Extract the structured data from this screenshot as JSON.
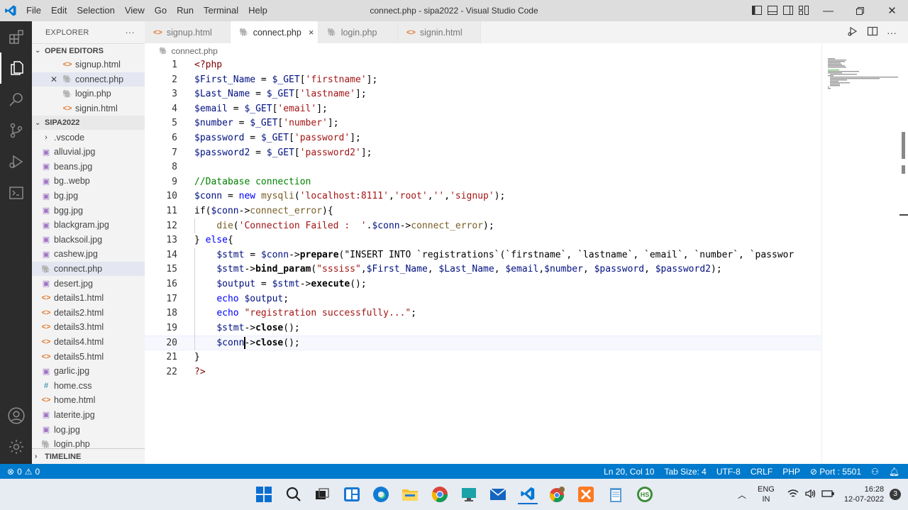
{
  "window": {
    "title": "connect.php - sipa2022 - Visual Studio Code",
    "menu": [
      "File",
      "Edit",
      "Selection",
      "View",
      "Go",
      "Run",
      "Terminal",
      "Help"
    ]
  },
  "sidebar": {
    "header": "EXPLORER",
    "more": "···",
    "open_editors_label": "OPEN EDITORS",
    "open_editors": [
      {
        "name": "signup.html",
        "icon": "html-icon"
      },
      {
        "name": "connect.php",
        "icon": "php-icon"
      },
      {
        "name": "login.php",
        "icon": "php-icon"
      },
      {
        "name": "signin.html",
        "icon": "html-icon"
      }
    ],
    "folder_label": "SIPA2022",
    "files": [
      {
        "name": ".vscode",
        "type": "folder"
      },
      {
        "name": "alluvial.jpg",
        "type": "img"
      },
      {
        "name": "beans.jpg",
        "type": "img"
      },
      {
        "name": "bg..webp",
        "type": "img"
      },
      {
        "name": "bg.jpg",
        "type": "img"
      },
      {
        "name": "bgg.jpg",
        "type": "img"
      },
      {
        "name": "blackgram.jpg",
        "type": "img"
      },
      {
        "name": "blacksoil.jpg",
        "type": "img"
      },
      {
        "name": "cashew.jpg",
        "type": "img"
      },
      {
        "name": "connect.php",
        "type": "php"
      },
      {
        "name": "desert.jpg",
        "type": "img"
      },
      {
        "name": "details1.html",
        "type": "html"
      },
      {
        "name": "details2.html",
        "type": "html"
      },
      {
        "name": "details3.html",
        "type": "html"
      },
      {
        "name": "details4.html",
        "type": "html"
      },
      {
        "name": "details5.html",
        "type": "html"
      },
      {
        "name": "garlic.jpg",
        "type": "img"
      },
      {
        "name": "home.css",
        "type": "css"
      },
      {
        "name": "home.html",
        "type": "html"
      },
      {
        "name": "laterite.jpg",
        "type": "img"
      },
      {
        "name": "log.jpg",
        "type": "img"
      },
      {
        "name": "login.php",
        "type": "php"
      }
    ],
    "timeline_label": "TIMELINE"
  },
  "tabs": [
    {
      "label": "signup.html",
      "icon": "html-icon"
    },
    {
      "label": "connect.php",
      "icon": "php-icon",
      "close": "×"
    },
    {
      "label": "login.php",
      "icon": "php-icon"
    },
    {
      "label": "signin.html",
      "icon": "html-icon"
    }
  ],
  "breadcrumb": "connect.php",
  "editor": {
    "line_numbers": [
      "1",
      "2",
      "3",
      "4",
      "5",
      "6",
      "7",
      "8",
      "9",
      "10",
      "11",
      "12",
      "13",
      "14",
      "15",
      "16",
      "17",
      "18",
      "19",
      "20",
      "21",
      "22"
    ],
    "lines": [
      "<?php",
      "$First_Name = $_GET['firstname'];",
      "$Last_Name = $_GET['lastname'];",
      "$email = $_GET['email'];",
      "$number = $_GET['number'];",
      "$password = $_GET['password'];",
      "$password2 = $_GET['password2'];",
      "",
      "//Database connection",
      "$conn = new mysqli('localhost:8111','root','','signup');",
      "if($conn->connect_error){",
      "    die('Connection Failed :  '.$conn->connect_error);",
      "} else{",
      "    $stmt = $conn->prepare(\"INSERT INTO `registrations`(`firstname`, `lastname`, `email`, `number`, `passwor",
      "    $stmt->bind_param(\"sssiss\",$First_Name, $Last_Name, $email,$number, $password, $password2);",
      "    $output = $stmt->execute();",
      "    echo $output;",
      "    echo \"registration successfully...\";",
      "    $stmt->close();",
      "    $conn->close();",
      "}",
      "?>"
    ],
    "current_line": 20
  },
  "statusbar": {
    "errors": "0",
    "warnings": "0",
    "position": "Ln 20, Col 10",
    "tab_size": "Tab Size: 4",
    "encoding": "UTF-8",
    "eol": "CRLF",
    "language": "PHP",
    "port": "Port : 5501"
  },
  "taskbar": {
    "lang": "ENG",
    "region": "IN",
    "time": "16:28",
    "date": "12-07-2022",
    "notifications": "3"
  }
}
